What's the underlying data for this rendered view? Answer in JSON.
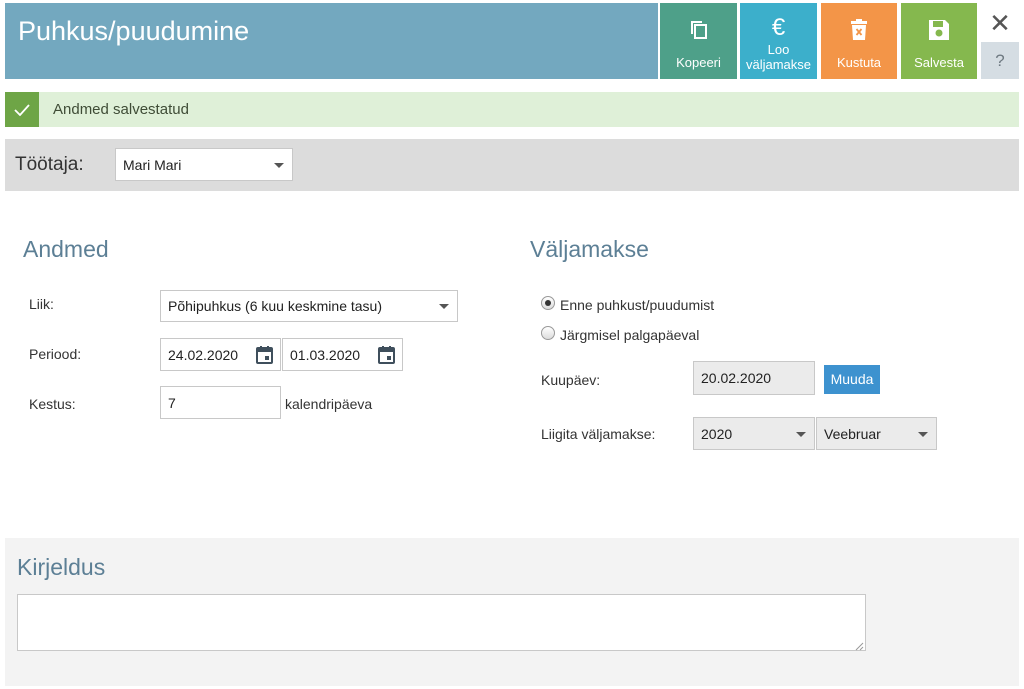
{
  "header": {
    "title": "Puhkus/puudumine",
    "buttons": {
      "copy": "Kopeeri",
      "payment_line1": "Loo",
      "payment_line2": "väljamakse",
      "delete": "Kustuta",
      "save": "Salvesta"
    },
    "close_glyph": "✕",
    "help_glyph": "?",
    "euro_glyph": "€",
    "colors": {
      "header": "#73a8bf",
      "copy": "#4ea089",
      "payment": "#3cafcb",
      "delete": "#f39548",
      "save": "#85b84e"
    }
  },
  "notification": {
    "text": "Andmed salvestatud",
    "icon": "check-icon"
  },
  "employee": {
    "label": "Töötaja:",
    "selected": "Mari Mari"
  },
  "andmed": {
    "title": "Andmed",
    "type_label": "Liik:",
    "type_value": "Põhipuhkus (6 kuu keskmine tasu)",
    "period_label": "Periood:",
    "period_start": "24.02.2020",
    "period_end": "01.03.2020",
    "duration_label": "Kestus:",
    "duration_value": "7",
    "duration_unit": "kalendripäeva"
  },
  "valjamakse": {
    "title": "Väljamakse",
    "option_before": "Enne puhkust/puudumist",
    "option_next": "Järgmisel palgapäeval",
    "selected_option": "before",
    "date_label": "Kuupäev:",
    "date_value": "20.02.2020",
    "change_button": "Muuda",
    "link_label": "Liigita väljamakse:",
    "link_year": "2020",
    "link_month": "Veebruar"
  },
  "description": {
    "title": "Kirjeldus",
    "value": ""
  }
}
